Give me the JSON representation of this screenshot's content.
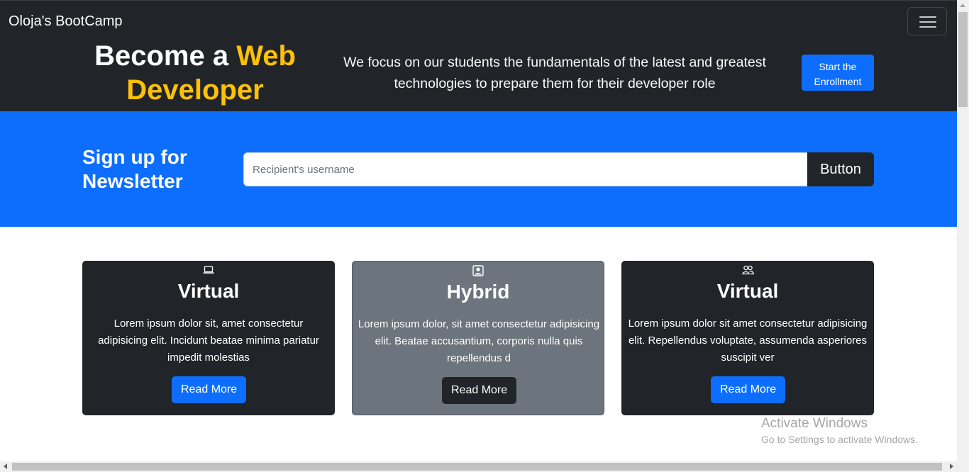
{
  "navbar": {
    "brand": "Oloja's BootCamp",
    "toggler_icon": "hamburger-menu-icon"
  },
  "hero": {
    "title_prefix": "Become a ",
    "title_accent": "Web Developer",
    "description": "We focus on our students the fundamentals of the latest and greatest technologies to prepare them for their developer role",
    "cta_label": "Start the Enrollment"
  },
  "newsletter": {
    "title": "Sign up for Newsletter",
    "input_placeholder": "Recipient's username",
    "input_value": "",
    "button_label": "Button"
  },
  "cards": [
    {
      "icon": "laptop-icon",
      "title": "Virtual",
      "text": "Lorem ipsum dolor sit, amet consectetur adipisicing elit. Incidunt beatae minima pariatur impedit molestias",
      "button_label": "Read More"
    },
    {
      "icon": "person-square-icon",
      "title": "Hybrid",
      "text": "Lorem ipsum dolor, sit amet consectetur adipisicing elit. Beatae accusantium, corporis nulla quis repellendus d",
      "button_label": "Read More"
    },
    {
      "icon": "people-icon",
      "title": "Virtual",
      "text": "Lorem ipsum dolor sit amet consectetur adipisicing elit. Repellendus voluptate, assumenda asperiores suscipit ver",
      "button_label": "Read More"
    }
  ],
  "watermark": {
    "title": "Activate Windows",
    "subtitle": "Go to Settings to activate Windows."
  },
  "colors": {
    "dark": "#212529",
    "primary": "#0d6efd",
    "accent": "#ffc107",
    "secondary": "#6c757d"
  }
}
